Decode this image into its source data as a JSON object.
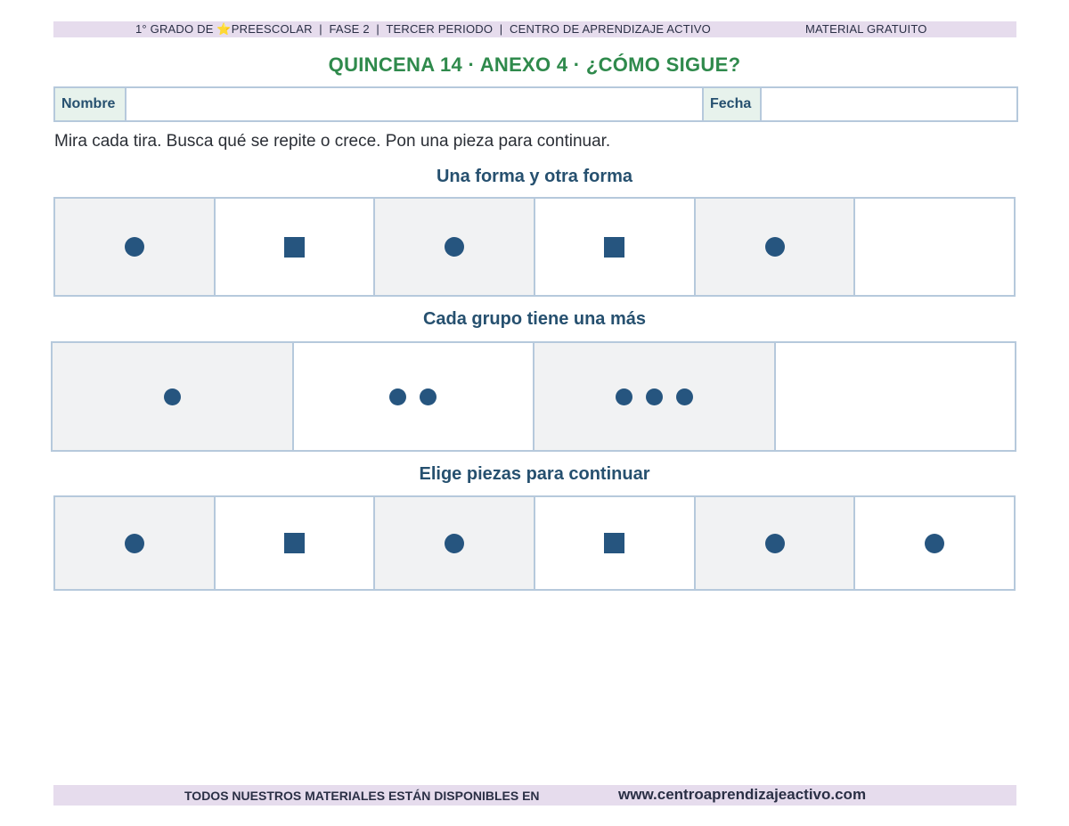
{
  "header": {
    "left_text_prefix": "1° GRADO DE ",
    "star_glyph": "⭐",
    "left_text_suffix": "PREESCOLAR  |  FASE 2  |  TERCER PERIODO  |  CENTRO DE APRENDIZAJE ACTIVO",
    "right_text": "MATERIAL GRATUITO"
  },
  "title": "QUINCENA 14 · ANEXO 4 · ¿CÓMO SIGUE?",
  "form": {
    "name_label": "Nombre",
    "date_label": "Fecha"
  },
  "instructions": "Mira cada tira. Busca qué se repite o crece. Pon una pieza para continuar.",
  "sections": [
    {
      "title": "Una forma y otra forma",
      "cells": [
        {
          "shape": "circle",
          "count": 1
        },
        {
          "shape": "square",
          "count": 1
        },
        {
          "shape": "circle",
          "count": 1
        },
        {
          "shape": "square",
          "count": 1
        },
        {
          "shape": "circle",
          "count": 1
        },
        {
          "shape": "empty",
          "count": 0
        }
      ]
    },
    {
      "title": "Cada grupo tiene una más",
      "cells": [
        {
          "shape": "circle",
          "count": 1
        },
        {
          "shape": "circle",
          "count": 2
        },
        {
          "shape": "circle",
          "count": 3
        },
        {
          "shape": "empty",
          "count": 0
        }
      ]
    },
    {
      "title": "Elige piezas para continuar",
      "cells": [
        {
          "shape": "circle",
          "count": 1
        },
        {
          "shape": "square",
          "count": 1
        },
        {
          "shape": "circle",
          "count": 1
        },
        {
          "shape": "square",
          "count": 1
        },
        {
          "shape": "circle",
          "count": 1
        },
        {
          "shape": "circle",
          "count": 1
        }
      ]
    }
  ],
  "footer": {
    "left_text": "TODOS NUESTROS MATERIALES ESTÁN DISPONIBLES EN",
    "url": "www.centroaprendizajeactivo.com"
  },
  "colors": {
    "title_green": "#2f8a4c",
    "heading_blue": "#26506f",
    "shape_blue": "#26557f",
    "bar_lilac": "#e6dced",
    "border_blue": "#b6c9dc"
  }
}
